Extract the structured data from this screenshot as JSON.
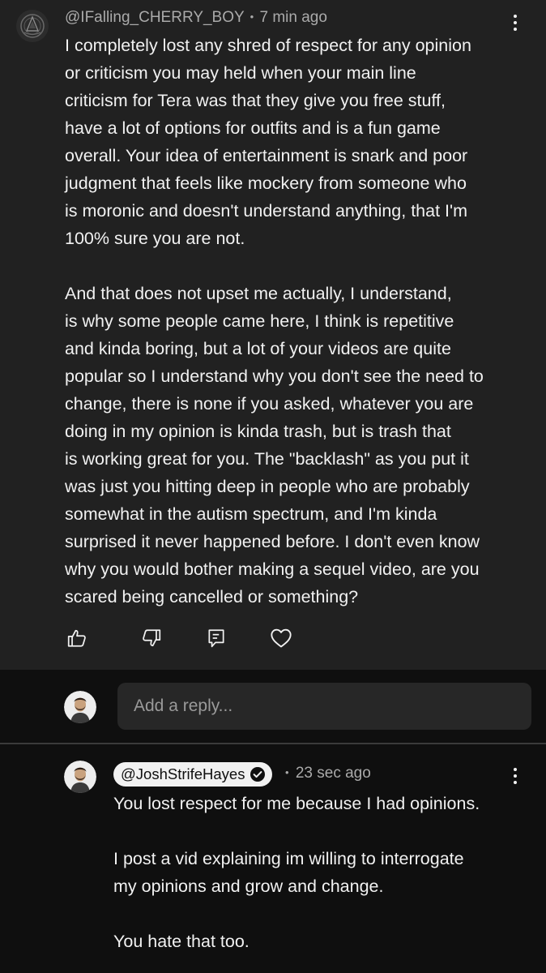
{
  "top_comment": {
    "author": "@IFalling_CHERRY_BOY",
    "separator": "•",
    "time": "7 min ago",
    "paragraph1": [
      "I completely lost any shred of respect for any opinion",
      "or criticism you may held when your main line",
      "criticism for Tera was that they give you free stuff,",
      "have a lot of options for outfits and is a fun game",
      "overall. Your idea of entertainment is snark and poor",
      "judgment that feels like mockery from someone who",
      "is moronic and doesn't understand anything, that I'm",
      "100% sure you are not."
    ],
    "paragraph2": [
      "And that does not upset me actually, I understand,",
      "is why some people came here, I think is repetitive",
      "and kinda boring, but a lot of your videos are quite",
      "popular so I understand why you don't see the need to",
      "change, there is none if you asked, whatever you are",
      "doing in my opinion is kinda trash, but is trash that",
      "is working great for you. The \"backlash\" as you put it",
      "was just you hitting deep in people who are probably",
      "somewhat in the autism spectrum, and I'm kinda",
      "surprised it never happened before. I don't even know",
      "why you would bother making a sequel video, are you",
      "scared being cancelled or something?"
    ],
    "actions": [
      "thumbs-up-icon",
      "thumbs-down-icon",
      "reply-icon",
      "heart-icon"
    ]
  },
  "reply_box": {
    "placeholder": "Add a reply..."
  },
  "reply": {
    "author": "@JoshStrifeHayes",
    "separator": "•",
    "time": "23 sec ago",
    "line1": "You lost respect for me because I had opinions.",
    "line2a": "I post a vid explaining im willing to interrogate",
    "line2b": "my opinions and grow and change.",
    "line3": "You hate that too."
  },
  "colors": {
    "top_comment_bg": "#212121",
    "page_bg": "#0f0f0f",
    "input_bg": "#272727",
    "secondary_text": "#aaaaaa",
    "primary_text": "#f1f1f1",
    "creator_chip_bg": "#f1f1f1"
  }
}
